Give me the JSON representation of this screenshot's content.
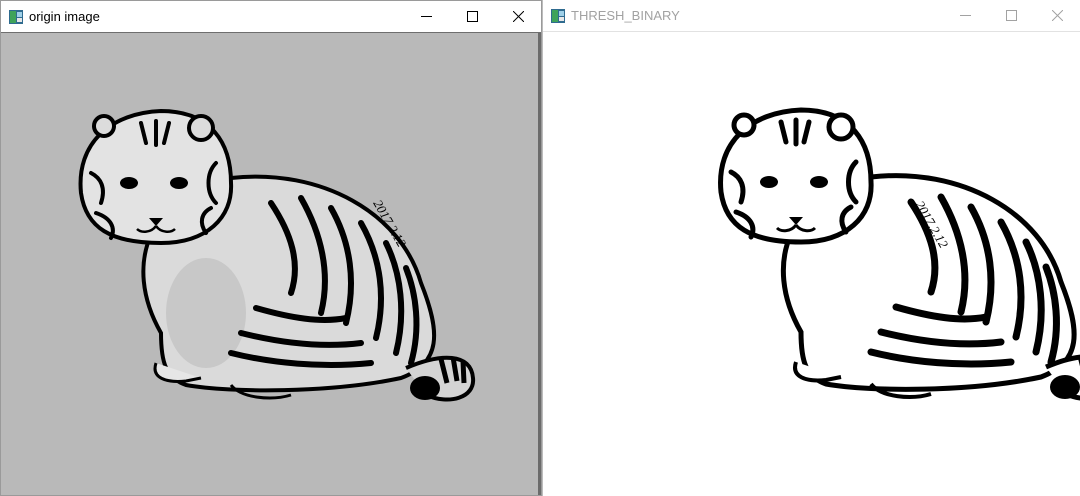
{
  "windows": [
    {
      "title": "origin image",
      "active": true,
      "controls": [
        "minimize",
        "maximize",
        "close"
      ],
      "image": {
        "subject": "tiger-drawing",
        "mode": "grayscale",
        "signature": "2017.2.12"
      }
    },
    {
      "title": "THRESH_BINARY",
      "active": false,
      "controls": [
        "minimize",
        "maximize",
        "close"
      ],
      "image": {
        "subject": "tiger-drawing",
        "mode": "binary-threshold",
        "signature": "2017.2.12"
      }
    }
  ],
  "colors": {
    "left_canvas": "#b9b9b9",
    "right_canvas": "#ffffff",
    "ink": "#000000",
    "inactive_title": "#a2a2a2"
  }
}
